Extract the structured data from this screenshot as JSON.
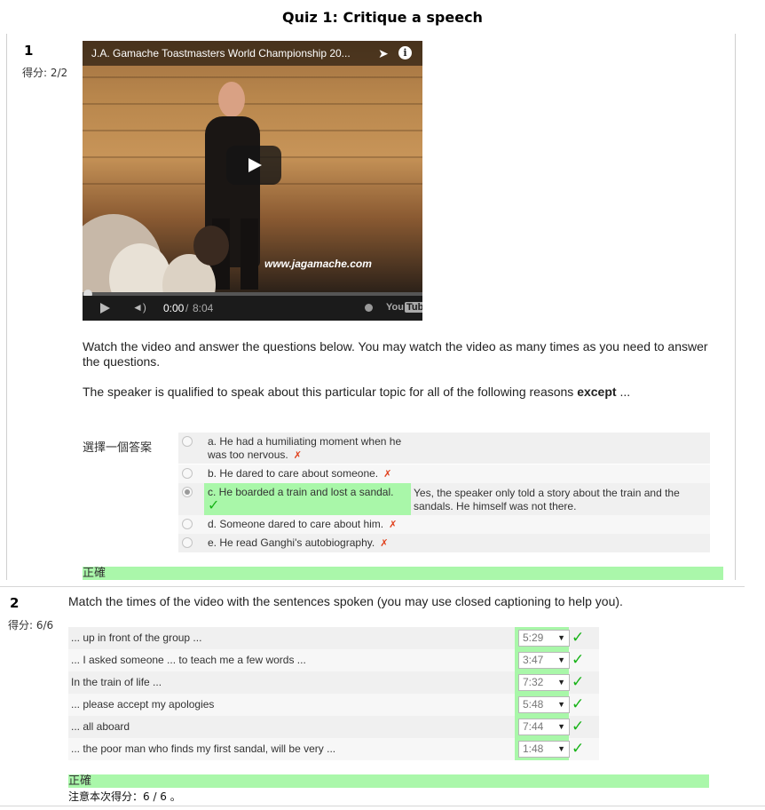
{
  "title": "Quiz 1: Critique a speech",
  "q1": {
    "number": "1",
    "grade": "得分: 2/2",
    "video": {
      "title": "J.A. Gamache Toastmasters World Championship 20...",
      "watermark": "www.jagamache.com",
      "time_current": "0:00",
      "time_sep": "/",
      "time_duration": "8:04",
      "progress": 0.0,
      "brand": "You",
      "brand_box": "Tube",
      "icons": [
        "share-icon",
        "info-icon",
        "play-icon",
        "volume-icon",
        "clock-icon",
        "youtube-logo"
      ]
    },
    "intro": "Watch the video and answer the questions below. You may watch the video as many times as you need to answer the questions.",
    "question_pre": "The speaker is qualified to speak about this particular topic for all of the following reasons",
    "question_bold": "except",
    "question_post": "...",
    "choose_label": "選擇一個答案",
    "options": [
      {
        "label": "a. He had a humiliating moment when he was too nervous.",
        "mark": "✗"
      },
      {
        "label": "b. He dared to care about someone.",
        "mark": "✗"
      },
      {
        "label": "c. He boarded a train and lost a sandal.",
        "mark": "✓",
        "feedback": "Yes, the speaker only told a story about the train and the sandals. He himself was not there."
      },
      {
        "label": "d. Someone dared to care about him.",
        "mark": "✗"
      },
      {
        "label": "e. He read Ganghi's autobiography.",
        "mark": "✗"
      }
    ],
    "selected": 2,
    "result": "正確"
  },
  "q2": {
    "number": "2",
    "grade": "得分: 6/6",
    "prompt": "Match the times of the video with the sentences spoken (you may use closed captioning to help you).",
    "rows": [
      {
        "text": "... up in front of the group ...",
        "value": "5:29",
        "mark": "✓"
      },
      {
        "text": "... I asked someone ... to teach me a few words ...",
        "value": "3:47",
        "mark": "✓"
      },
      {
        "text": "In the train of life ...",
        "value": "7:32",
        "mark": "✓"
      },
      {
        "text": "... please accept my apologies",
        "value": "5:48",
        "mark": "✓"
      },
      {
        "text": "... all aboard",
        "value": "7:44",
        "mark": "✓"
      },
      {
        "text": "... the poor man who finds my first sandal, will be very ...",
        "value": "1:48",
        "mark": "✓"
      }
    ],
    "select_arrow": "▼",
    "result": "正確",
    "score_note": "注意本次得分：6 / 6 。"
  },
  "colors": {
    "correct_bg": "#aaf7aa",
    "check": "#17b317",
    "cross": "#e0401c"
  }
}
